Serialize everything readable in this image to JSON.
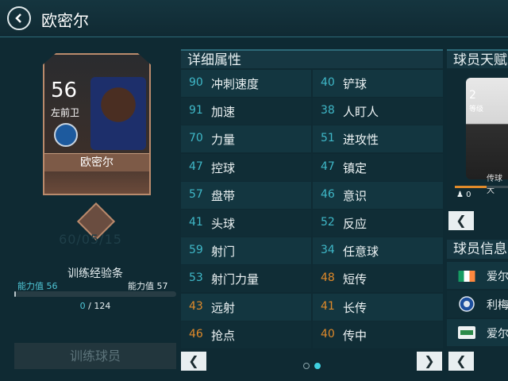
{
  "header": {
    "title": "欧密尔"
  },
  "player_card": {
    "rating": "56",
    "position": "左前卫",
    "name": "欧密尔"
  },
  "ghost_text": "60/05/15",
  "training": {
    "title": "训练经验条",
    "left_label": "能力值",
    "left_value": "56",
    "right_label": "能力值",
    "right_value": "57",
    "current": "0",
    "separator": "/",
    "total": "124",
    "progress": 0.01,
    "button_label": "训练球员"
  },
  "attributes": {
    "title": "详细属性",
    "rows": [
      [
        {
          "value": "90",
          "name": "冲刺速度",
          "color": "teal"
        },
        {
          "value": "40",
          "name": "铲球",
          "color": "teal"
        }
      ],
      [
        {
          "value": "91",
          "name": "加速",
          "color": "teal"
        },
        {
          "value": "38",
          "name": "人盯人",
          "color": "teal"
        }
      ],
      [
        {
          "value": "70",
          "name": "力量",
          "color": "teal"
        },
        {
          "value": "51",
          "name": "进攻性",
          "color": "teal"
        }
      ],
      [
        {
          "value": "47",
          "name": "控球",
          "color": "teal"
        },
        {
          "value": "47",
          "name": "镇定",
          "color": "teal"
        }
      ],
      [
        {
          "value": "57",
          "name": "盘带",
          "color": "teal"
        },
        {
          "value": "46",
          "name": "意识",
          "color": "teal"
        }
      ],
      [
        {
          "value": "41",
          "name": "头球",
          "color": "teal"
        },
        {
          "value": "52",
          "name": "反应",
          "color": "teal"
        }
      ],
      [
        {
          "value": "59",
          "name": "射门",
          "color": "teal"
        },
        {
          "value": "34",
          "name": "任意球",
          "color": "teal"
        }
      ],
      [
        {
          "value": "53",
          "name": "射门力量",
          "color": "teal"
        },
        {
          "value": "48",
          "name": "短传",
          "color": "orange"
        }
      ],
      [
        {
          "value": "43",
          "name": "远射",
          "color": "orange"
        },
        {
          "value": "41",
          "name": "长传",
          "color": "orange"
        }
      ],
      [
        {
          "value": "46",
          "name": "抢点",
          "color": "orange"
        },
        {
          "value": "40",
          "name": "传中",
          "color": "orange"
        }
      ]
    ],
    "page_count": 2,
    "active_page": 2
  },
  "talent": {
    "title": "球员天赋",
    "level": "2",
    "level_label": "等级",
    "name": "传球大",
    "count": "0"
  },
  "info": {
    "title": "球员信息",
    "rows": [
      {
        "text": "爱尔",
        "icon": "ireland-flag-icon"
      },
      {
        "text": "利梅",
        "icon": "club-badge-icon"
      },
      {
        "text": "爱尔",
        "icon": "league-logo-icon"
      }
    ]
  },
  "colors": {
    "teal": "#3fb8c8",
    "orange": "#e08a2a",
    "panel": "#0f2a33"
  }
}
